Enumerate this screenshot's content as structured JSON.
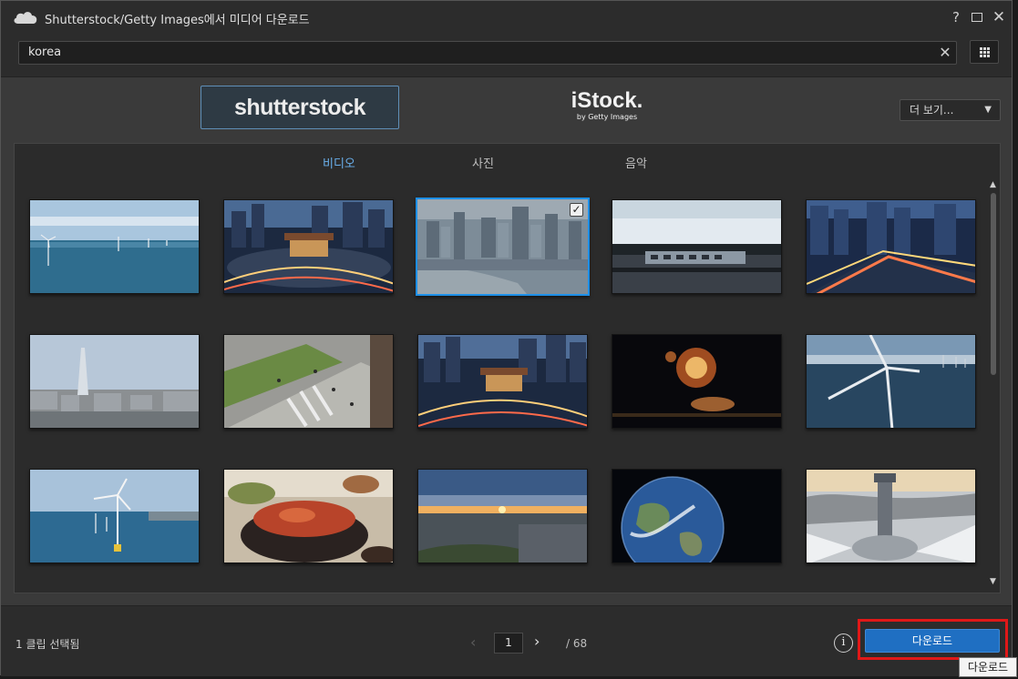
{
  "window": {
    "title": "Shutterstock/Getty Images에서 미디어 다운로드",
    "icons": {
      "app": "cloud-icon",
      "help": "help-icon",
      "maximize": "maximize-icon",
      "close": "close-icon"
    },
    "help_glyph": "?",
    "close_glyph": "✕"
  },
  "search": {
    "value": "korea",
    "clear_glyph": "✕",
    "icons": {
      "clear": "clear-icon",
      "view": "grid-view-icon"
    }
  },
  "providers": {
    "shutterstock": "shutterstock",
    "istock_main": "iStock.",
    "istock_sub": "by Getty Images",
    "more_label": "더 보기...",
    "more_caret": "▼"
  },
  "tabs": [
    {
      "label": "비디오",
      "active": true
    },
    {
      "label": "사진",
      "active": false
    },
    {
      "label": "음악",
      "active": false
    }
  ],
  "thumbnails": [
    {
      "subject": "offshore wind turbines",
      "selected": false
    },
    {
      "subject": "night city gate traffic",
      "selected": false
    },
    {
      "subject": "city skyline river",
      "selected": true
    },
    {
      "subject": "train on bridge",
      "selected": false
    },
    {
      "subject": "night city intersection",
      "selected": false
    },
    {
      "subject": "lotte tower cityscape",
      "selected": false
    },
    {
      "subject": "street crosswalk aerial",
      "selected": false
    },
    {
      "subject": "night city gate",
      "selected": false
    },
    {
      "subject": "fireworks",
      "selected": false
    },
    {
      "subject": "wind turbine closeup",
      "selected": false
    },
    {
      "subject": "wind turbines sea",
      "selected": false
    },
    {
      "subject": "kimchi stew",
      "selected": false
    },
    {
      "subject": "sunset city",
      "selected": false
    },
    {
      "subject": "earth from space",
      "selected": false
    },
    {
      "subject": "ski jump tower",
      "selected": false
    }
  ],
  "check_glyph": "✓",
  "scroll": {
    "up": "▲",
    "down": "▼"
  },
  "footer": {
    "selected_count": "1 클립 선택됨",
    "prev": "‹",
    "page": "1",
    "next": "›",
    "total": "/ 68",
    "info_glyph": "i",
    "download_label": "다운로드",
    "tooltip": "다운로드"
  },
  "colors": {
    "accent": "#1d8fe8",
    "button": "#1f6fc2",
    "highlight": "#e01818",
    "active_tab": "#6ab0ec"
  }
}
